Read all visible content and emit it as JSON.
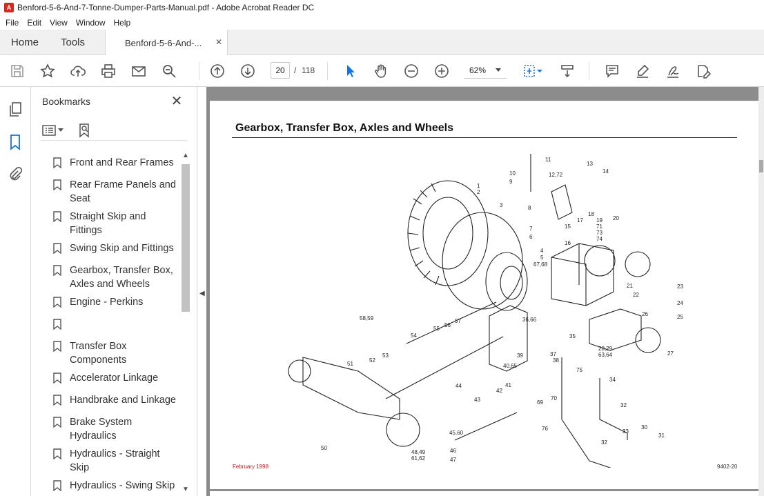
{
  "window": {
    "title": "Benford-5-6-And-7-Tonne-Dumper-Parts-Manual.pdf - Adobe Acrobat Reader DC"
  },
  "menu": [
    "File",
    "Edit",
    "View",
    "Window",
    "Help"
  ],
  "tabs": {
    "home": "Home",
    "tools": "Tools",
    "document": "Benford-5-6-And-...",
    "close_glyph": "✕"
  },
  "toolbar": {
    "current_page": "20",
    "page_separator": "/",
    "total_pages": "118",
    "zoom": "62%",
    "accent_color": "#1473e6"
  },
  "bookmarks": {
    "title": "Bookmarks",
    "close_glyph": "✕",
    "items": [
      "Front and Rear Frames",
      "Rear Frame Panels and Seat",
      "Straight Skip and Fittings",
      "Swing Skip and Fittings",
      "Gearbox, Transfer Box, Axles and Wheels",
      "Engine - Perkins",
      "",
      "Transfer Box Components",
      "Accelerator Linkage",
      "Handbrake and Linkage",
      "Brake System Hydraulics",
      "Hydraulics - Straight Skip",
      "Hydraulics - Swing Skip"
    ]
  },
  "page": {
    "heading": "Gearbox, Transfer Box, Axles and Wheels",
    "footer_date": "February 1998",
    "footer_ref": "9402-20",
    "callouts": [
      "1",
      "2",
      "3",
      "4",
      "5",
      "67,68",
      "6",
      "7",
      "8",
      "9",
      "10",
      "11",
      "12,72",
      "13",
      "14",
      "15",
      "16",
      "17",
      "18",
      "19",
      "71",
      "73",
      "74",
      "20",
      "21",
      "22",
      "23",
      "24",
      "25",
      "26",
      "27",
      "28,29",
      "63,64",
      "30",
      "31",
      "32",
      "32",
      "33",
      "34",
      "35",
      "36,66",
      "37",
      "38",
      "39",
      "40,65",
      "41",
      "42",
      "43",
      "44",
      "45,60",
      "46",
      "47",
      "48,49",
      "61,62",
      "50",
      "51",
      "52",
      "53",
      "54",
      "55",
      "56",
      "57",
      "58,59",
      "69",
      "70",
      "75",
      "76"
    ]
  }
}
